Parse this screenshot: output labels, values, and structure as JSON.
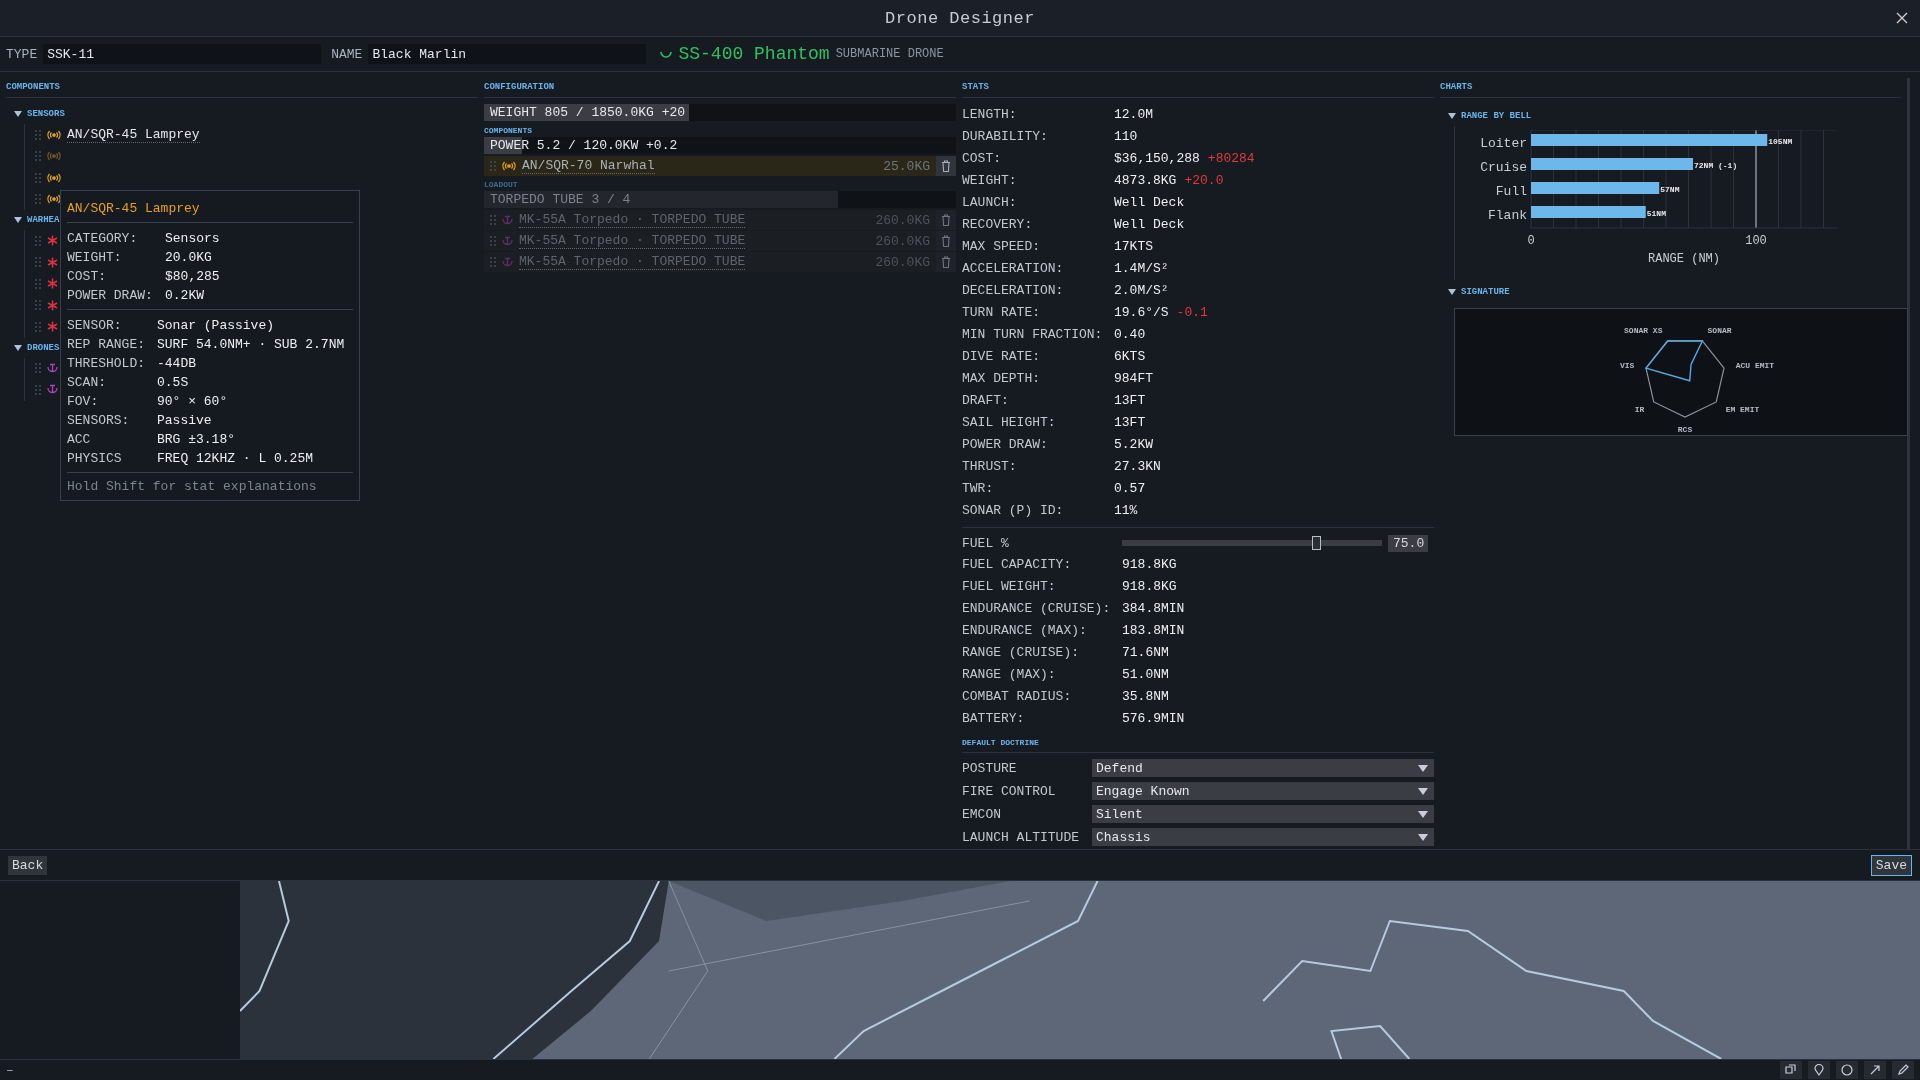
{
  "window": {
    "title": "Drone Designer"
  },
  "header": {
    "type_label": "TYPE",
    "type_value": "SSK-11",
    "name_label": "NAME",
    "name_value": "Black Marlin",
    "model": "SS-400 Phantom",
    "model_class": "SUBMARINE DRONE"
  },
  "components": {
    "title": "COMPONENTS",
    "groups": [
      {
        "label": "SENSORS",
        "expanded": true,
        "items": [
          {
            "kind": "sensor",
            "label": "AN/SQR-45 Lamprey",
            "disabled": false
          },
          {
            "kind": "sensor",
            "disabled": true
          },
          {
            "kind": "sensor",
            "disabled": false
          },
          {
            "kind": "sensor",
            "disabled": false
          }
        ]
      },
      {
        "label": "WARHEA",
        "expanded": true,
        "items": [
          {
            "kind": "warhead",
            "disabled": false
          },
          {
            "kind": "warhead",
            "disabled": false
          },
          {
            "kind": "warhead",
            "disabled": false
          },
          {
            "kind": "warhead",
            "disabled": false
          },
          {
            "kind": "warhead",
            "disabled": false
          }
        ]
      },
      {
        "label": "DRONES",
        "expanded": true,
        "items": [
          {
            "kind": "drone",
            "disabled": false
          },
          {
            "kind": "drone",
            "disabled": false
          }
        ]
      }
    ]
  },
  "tooltip": {
    "title": "AN/SQR-45 Lamprey",
    "sections": [
      [
        {
          "label": "CATEGORY:",
          "value": "Sensors"
        },
        {
          "label": "WEIGHT:",
          "value": "20.0KG"
        },
        {
          "label": "COST:",
          "value": "$80,285"
        },
        {
          "label": "POWER DRAW:",
          "value": "0.2KW"
        }
      ],
      [
        {
          "label": "SENSOR:",
          "value": "Sonar (Passive)"
        },
        {
          "label": "REP RANGE:",
          "value": "SURF 54.0NM+ · SUB 2.7NM"
        },
        {
          "label": "THRESHOLD:",
          "value": "-44DB"
        },
        {
          "label": "SCAN:",
          "value": "0.5S"
        },
        {
          "label": "FOV:",
          "value": "90° × 60°"
        },
        {
          "label": "SENSORS:",
          "value": "Passive"
        },
        {
          "label": "ACC",
          "value": "BRG ±3.18°"
        },
        {
          "label": "PHYSICS",
          "value": "FREQ 12KHZ · L 0.25M"
        }
      ]
    ],
    "hint": "Hold Shift for stat explanations"
  },
  "configuration": {
    "title": "CONFIGURATION",
    "weight_bar": {
      "text": "WEIGHT 805 / 1850.0KG +20",
      "level": 0.435
    },
    "components_title": "COMPONENTS",
    "power_bar": {
      "text": "POWER 5.2 / 120.0KW +0.2",
      "level": 0.08
    },
    "components": [
      {
        "kind": "sensor",
        "label": "AN/SQR-70 Narwhal",
        "weight": "25.0KG",
        "disabled": false
      }
    ],
    "loadout_title": "LOADOUT",
    "loadout_bar": {
      "text": "TORPEDO TUBE 3 / 4",
      "level": 0.75
    },
    "loadout": [
      {
        "kind": "drone",
        "label": "MK-55A Torpedo · TORPEDO TUBE",
        "weight": "260.0KG",
        "disabled": true
      },
      {
        "kind": "drone",
        "label": "MK-55A Torpedo · TORPEDO TUBE",
        "weight": "260.0KG",
        "disabled": true
      },
      {
        "kind": "drone",
        "label": "MK-55A Torpedo · TORPEDO TUBE",
        "weight": "260.0KG",
        "disabled": true
      }
    ]
  },
  "stats": {
    "title": "STATS",
    "rows": [
      {
        "label": "LENGTH:",
        "value": "12.0M"
      },
      {
        "label": "DURABILITY:",
        "value": "110"
      },
      {
        "label": "COST:",
        "value": "$36,150,288",
        "delta": "+80284"
      },
      {
        "label": "WEIGHT:",
        "value": "4873.8KG",
        "delta": "+20.0"
      },
      {
        "label": "LAUNCH:",
        "value": "Well Deck"
      },
      {
        "label": "RECOVERY:",
        "value": "Well Deck"
      },
      {
        "label": "MAX SPEED:",
        "value": "17KTS"
      },
      {
        "label": "ACCELERATION:",
        "value": "1.4M/S²"
      },
      {
        "label": "DECELERATION:",
        "value": "2.0M/S²"
      },
      {
        "label": "TURN RATE:",
        "value": "19.6°/S",
        "delta": "-0.1"
      },
      {
        "label": "MIN TURN FRACTION:",
        "value": "0.40"
      },
      {
        "label": "DIVE RATE:",
        "value": "6KTS"
      },
      {
        "label": "MAX DEPTH:",
        "value": "984FT"
      },
      {
        "label": "DRAFT:",
        "value": "13FT"
      },
      {
        "label": "SAIL HEIGHT:",
        "value": "13FT"
      },
      {
        "label": "POWER DRAW:",
        "value": "5.2KW"
      },
      {
        "label": "THRUST:",
        "value": "27.3KN"
      },
      {
        "label": "TWR:",
        "value": "0.57"
      },
      {
        "label": "SONAR (P) ID:",
        "value": "11%"
      }
    ],
    "fuel": {
      "label": "FUEL %",
      "level": 0.75,
      "value": "75.0"
    },
    "fuel_rows": [
      {
        "label": "FUEL CAPACITY:",
        "value": "918.8KG"
      },
      {
        "label": "FUEL WEIGHT:",
        "value": "918.8KG"
      },
      {
        "label": "ENDURANCE (CRUISE):",
        "value": "384.8MIN"
      },
      {
        "label": "ENDURANCE (MAX):",
        "value": "183.8MIN"
      },
      {
        "label": "RANGE (CRUISE):",
        "value": "71.6NM"
      },
      {
        "label": "RANGE (MAX):",
        "value": "51.0NM"
      },
      {
        "label": "COMBAT RADIUS:",
        "value": "35.8NM"
      },
      {
        "label": "BATTERY:",
        "value": "576.9MIN"
      }
    ],
    "doctrine_title": "DEFAULT DOCTRINE",
    "doctrine": [
      {
        "label": "POSTURE",
        "value": "Defend"
      },
      {
        "label": "FIRE CONTROL",
        "value": "Engage Known"
      },
      {
        "label": "EMCON",
        "value": "Silent"
      },
      {
        "label": "LAUNCH ALTITUDE",
        "value": "Chassis"
      }
    ]
  },
  "charts": {
    "title": "CHARTS",
    "range": {
      "title": "RANGE BY BELL",
      "expanded": true,
      "chart_data": {
        "type": "bar",
        "orientation": "horizontal",
        "categories": [
          "Loiter",
          "Cruise",
          "Full",
          "Flank"
        ],
        "values": [
          105,
          72,
          57,
          51
        ],
        "value_labels": [
          "105NM",
          "72NM (-1)",
          "57NM",
          "51NM"
        ],
        "xlabel": "RANGE (NM)",
        "xlim": [
          0,
          136
        ],
        "xticks": [
          0,
          100
        ]
      }
    },
    "signature": {
      "title": "SIGNATURE",
      "expanded": true,
      "axes": [
        "SONAR XS",
        "SONAR",
        "ACU EMIT",
        "EM EMIT",
        "RCS",
        "IR",
        "VIS"
      ]
    }
  },
  "footer": {
    "back": "Back",
    "save": "Save"
  },
  "status_bar": {
    "text": "–"
  }
}
